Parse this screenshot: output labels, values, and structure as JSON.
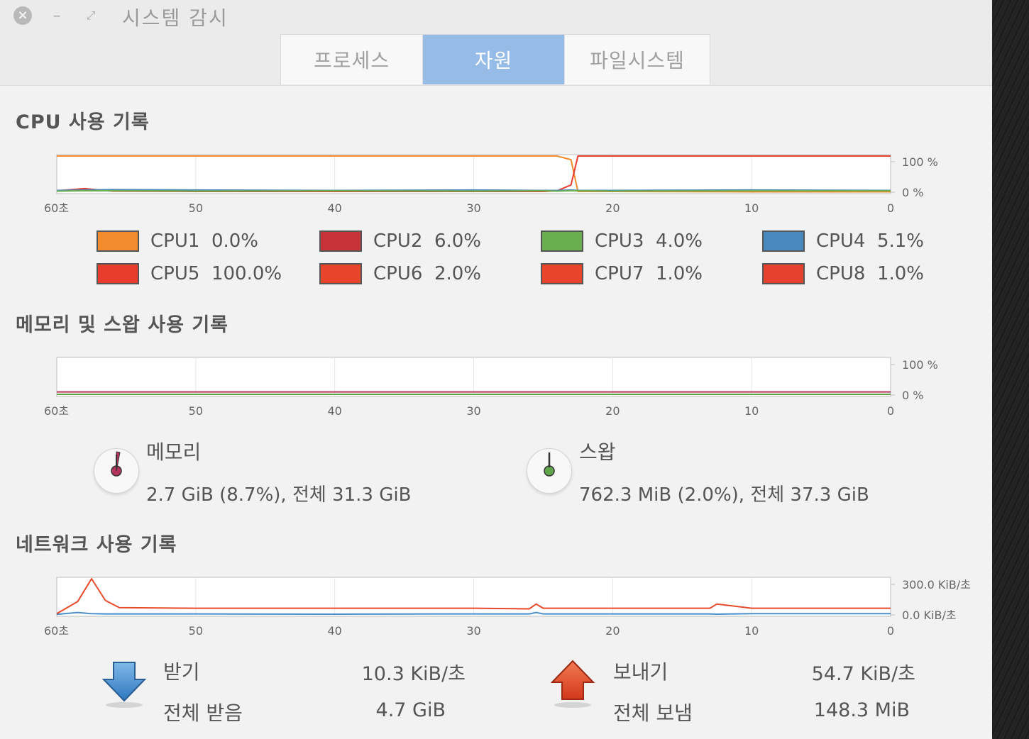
{
  "window": {
    "title": "시스템 감시",
    "controls": {
      "close": "×",
      "minimize": "–",
      "maximize": "⤢"
    }
  },
  "tabs": [
    {
      "label": "프로세스",
      "active": false
    },
    {
      "label": "자원",
      "active": true
    },
    {
      "label": "파일시스템",
      "active": false
    }
  ],
  "cpu": {
    "title": "CPU 사용 기록",
    "x_ticks": [
      "60초",
      "50",
      "40",
      "30",
      "20",
      "10",
      "0"
    ],
    "y_ticks": [
      "100 %",
      "0 %"
    ],
    "legend": [
      {
        "name": "CPU1",
        "value": "0.0%",
        "color": "#f28a2e"
      },
      {
        "name": "CPU2",
        "value": "6.0%",
        "color": "#c8333a"
      },
      {
        "name": "CPU3",
        "value": "4.0%",
        "color": "#6aaf4f"
      },
      {
        "name": "CPU4",
        "value": "5.1%",
        "color": "#4a89bd"
      },
      {
        "name": "CPU5",
        "value": "100.0%",
        "color": "#e83c2c"
      },
      {
        "name": "CPU6",
        "value": "2.0%",
        "color": "#e8442a"
      },
      {
        "name": "CPU7",
        "value": "1.0%",
        "color": "#e8432b"
      },
      {
        "name": "CPU8",
        "value": "1.0%",
        "color": "#e6412e"
      }
    ]
  },
  "memory": {
    "title": "메모리 및 스왑 사용 기록",
    "x_ticks": [
      "60초",
      "50",
      "40",
      "30",
      "20",
      "10",
      "0"
    ],
    "y_ticks": [
      "100 %",
      "0 %"
    ],
    "mem_label": "메모리",
    "mem_value": "2.7 GiB (8.7%), 전체 31.3 GiB",
    "mem_color": "#b3355c",
    "swap_label": "스왑",
    "swap_value": "762.3 MiB (2.0%), 전체 37.3 GiB",
    "swap_color": "#5fa54a"
  },
  "network": {
    "title": "네트워크 사용 기록",
    "x_ticks": [
      "60초",
      "50",
      "40",
      "30",
      "20",
      "10",
      "0"
    ],
    "y_ticks": [
      "300.0 KiB/초",
      "0.0 KiB/초"
    ],
    "recv_label": "받기",
    "recv_rate": "10.3 KiB/초",
    "recv_total_label": "전체 받음",
    "recv_total": "4.7 GiB",
    "send_label": "보내기",
    "send_rate": "54.7 KiB/초",
    "send_total_label": "전체 보냄",
    "send_total": "148.3 MiB",
    "recv_color": "#4a8fcb",
    "send_color": "#e84a2a"
  },
  "chart_data": [
    {
      "type": "line",
      "title": "CPU 사용 기록",
      "x": [
        60,
        58,
        56,
        50,
        40,
        30,
        25,
        24,
        23,
        22.5,
        20,
        10,
        0
      ],
      "ylim": [
        0,
        100
      ],
      "series": [
        {
          "name": "CPU1",
          "values": [
            100,
            100,
            100,
            100,
            100,
            100,
            100,
            100,
            90,
            2,
            2,
            1,
            1
          ]
        },
        {
          "name": "CPU5",
          "values": [
            4,
            10,
            3,
            2,
            2,
            2,
            2,
            4,
            20,
            100,
            100,
            100,
            100
          ]
        },
        {
          "name": "CPU4",
          "values": [
            5,
            6,
            7,
            6,
            5,
            6,
            5,
            5,
            6,
            5,
            5,
            6,
            5
          ]
        },
        {
          "name": "CPU3",
          "values": [
            3,
            4,
            4,
            3,
            4,
            3,
            4,
            3,
            4,
            4,
            3,
            4,
            4
          ]
        }
      ]
    },
    {
      "type": "line",
      "title": "메모리 및 스왑 사용 기록",
      "x": [
        60,
        0
      ],
      "ylim": [
        0,
        100
      ],
      "series": [
        {
          "name": "메모리",
          "values": [
            8.7,
            8.7
          ]
        },
        {
          "name": "스왑",
          "values": [
            2.0,
            2.0
          ]
        }
      ]
    },
    {
      "type": "line",
      "title": "네트워크 사용 기록",
      "x": [
        60,
        58.5,
        57.5,
        56.5,
        55.5,
        50,
        40,
        30,
        26,
        25.5,
        25,
        20,
        13,
        12.5,
        10,
        0
      ],
      "ylim": [
        0,
        300
      ],
      "series": [
        {
          "name": "받기",
          "values": [
            5,
            20,
            10,
            8,
            8,
            8,
            6,
            8,
            8,
            20,
            8,
            8,
            8,
            6,
            10,
            10
          ]
        },
        {
          "name": "보내기",
          "values": [
            10,
            110,
            300,
            120,
            60,
            55,
            55,
            55,
            50,
            90,
            55,
            55,
            55,
            90,
            55,
            55
          ]
        }
      ]
    }
  ]
}
